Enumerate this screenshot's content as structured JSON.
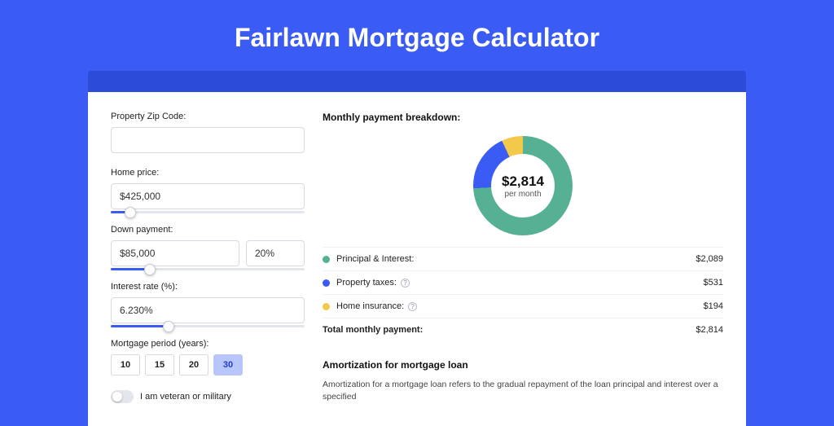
{
  "title": "Fairlawn Mortgage Calculator",
  "form": {
    "zip_label": "Property Zip Code:",
    "zip_value": "",
    "price_label": "Home price:",
    "price_value": "$425,000",
    "price_slider_pct": 10,
    "down_label": "Down payment:",
    "down_amount": "$85,000",
    "down_pct": "20%",
    "down_slider_pct": 20,
    "rate_label": "Interest rate (%):",
    "rate_value": "6.230%",
    "rate_slider_pct": 30,
    "period_label": "Mortgage period (years):",
    "periods": [
      "10",
      "15",
      "20",
      "30"
    ],
    "period_selected": "30",
    "veteran_label": "I am veteran or military"
  },
  "breakdown": {
    "heading": "Monthly payment breakdown:",
    "donut_value": "$2,814",
    "donut_sub": "per month",
    "rows": [
      {
        "label": "Principal & Interest:",
        "value": "$2,089",
        "color": "#56b093",
        "info": false
      },
      {
        "label": "Property taxes:",
        "value": "$531",
        "color": "#3b5bf5",
        "info": true
      },
      {
        "label": "Home insurance:",
        "value": "$194",
        "color": "#f3c94b",
        "info": true
      }
    ],
    "total_label": "Total monthly payment:",
    "total_value": "$2,814"
  },
  "amort": {
    "heading": "Amortization for mortgage loan",
    "body": "Amortization for a mortgage loan refers to the gradual repayment of the loan principal and interest over a specified"
  },
  "chart_data": {
    "type": "pie",
    "title": "Monthly payment breakdown",
    "series": [
      {
        "name": "Principal & Interest",
        "value": 2089,
        "color": "#56b093"
      },
      {
        "name": "Property taxes",
        "value": 531,
        "color": "#3b5bf5"
      },
      {
        "name": "Home insurance",
        "value": 194,
        "color": "#f3c94b"
      }
    ],
    "total": 2814,
    "center_label": "$2,814 per month"
  }
}
